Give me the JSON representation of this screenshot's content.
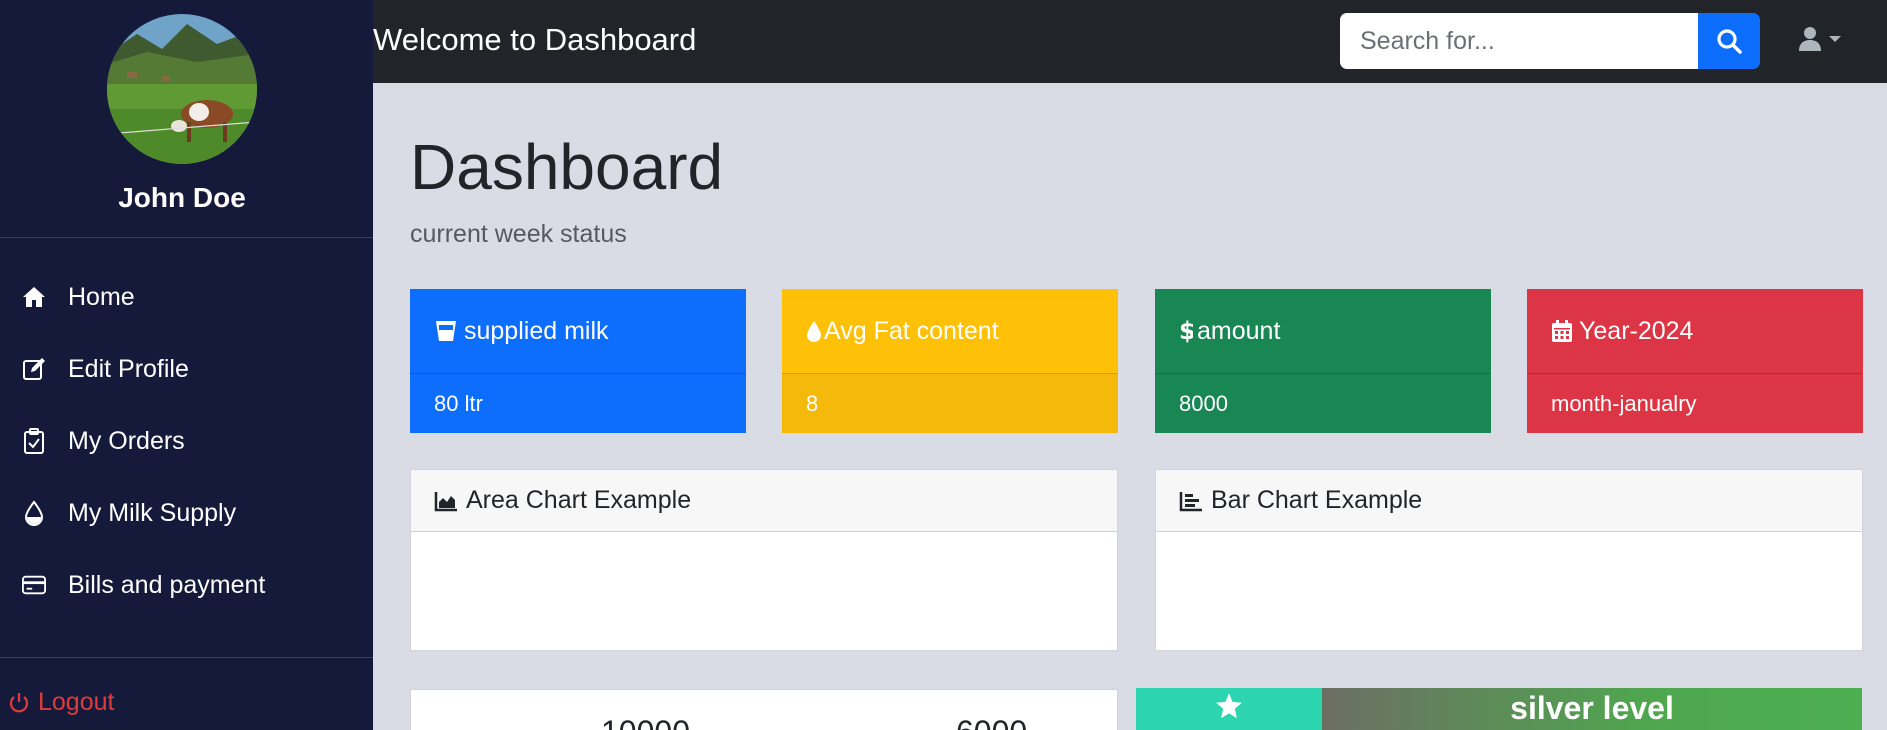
{
  "sidebar": {
    "user_name": "John Doe",
    "nav": [
      {
        "label": "Home",
        "icon": "home-icon"
      },
      {
        "label": "Edit Profile",
        "icon": "edit-icon"
      },
      {
        "label": "My Orders",
        "icon": "clipboard-icon"
      },
      {
        "label": "My Milk Supply",
        "icon": "drop-icon"
      },
      {
        "label": "Bills and payment",
        "icon": "credit-card-icon"
      }
    ],
    "logout_label": "Logout"
  },
  "topbar": {
    "welcome": "Welcome to Dashboard",
    "search_placeholder": "Search for..."
  },
  "main": {
    "title": "Dashboard",
    "subtitle": "current week status",
    "cards": [
      {
        "title": "supplied milk",
        "value": "80 ltr",
        "color": "#0d6efd",
        "icon": "milk-cup-icon"
      },
      {
        "title": "Avg Fat content",
        "value": "8",
        "color": "#ffc107",
        "icon": "drop-icon"
      },
      {
        "title": "amount",
        "value": "8000",
        "color": "#198754",
        "icon": "dollar-icon"
      },
      {
        "title": "Year-2024",
        "value": "month-janualry",
        "color": "#dc3545",
        "icon": "calendar-icon"
      }
    ],
    "panels": [
      {
        "title": "Area Chart Example",
        "icon": "area-chart-icon"
      },
      {
        "title": "Bar Chart Example",
        "icon": "bar-chart-icon"
      }
    ],
    "stats": [
      "10000",
      "6000"
    ],
    "level": "silver level"
  }
}
